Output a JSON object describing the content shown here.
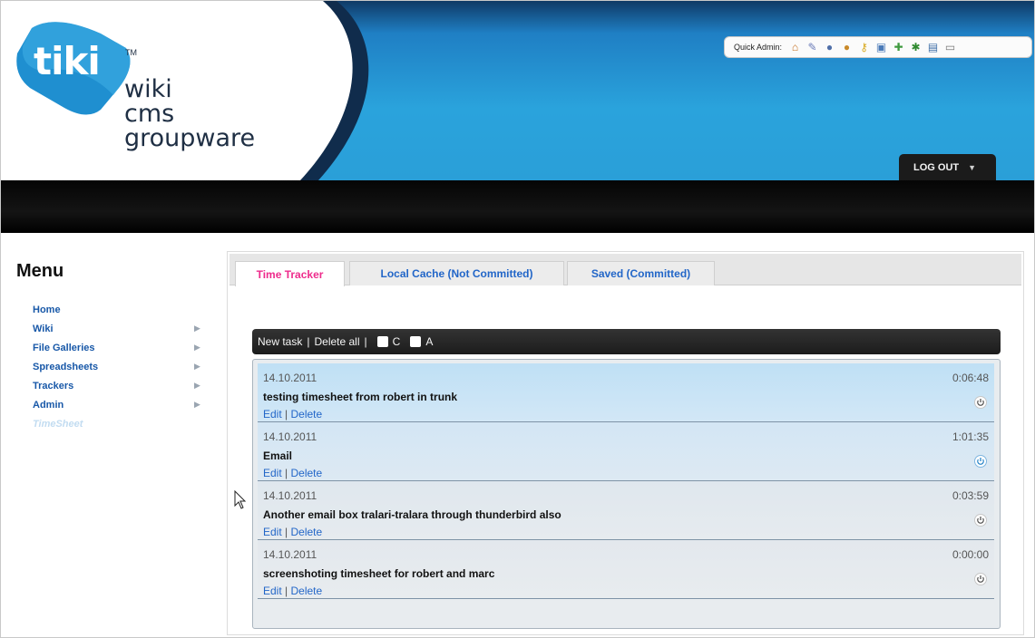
{
  "header": {
    "logo_word": "tiki",
    "trademark": "TM",
    "logo_lines": [
      "wiki",
      "cms",
      "groupware"
    ],
    "quick_admin_label": "Quick Admin:",
    "quick_admin_icons": [
      "home-icon",
      "brush-icon",
      "user-icon",
      "users-icon",
      "key-icon",
      "window-icon",
      "puzzle-icon",
      "plugin-icon",
      "document-icon",
      "keyboard-icon"
    ],
    "logout_label": "LOG OUT"
  },
  "menu": {
    "title": "Menu",
    "items": [
      {
        "label": "Home",
        "has_submenu": false
      },
      {
        "label": "Wiki",
        "has_submenu": true
      },
      {
        "label": "File Galleries",
        "has_submenu": true
      },
      {
        "label": "Spreadsheets",
        "has_submenu": true
      },
      {
        "label": "Trackers",
        "has_submenu": true
      },
      {
        "label": "Admin",
        "has_submenu": true
      },
      {
        "label": "TimeSheet",
        "has_submenu": false
      }
    ]
  },
  "tabs": [
    {
      "label": "Time Tracker",
      "active": true
    },
    {
      "label": "Local Cache (Not Committed)",
      "active": false
    },
    {
      "label": "Saved (Committed)",
      "active": false
    }
  ],
  "toolbar": {
    "new_task": "New task",
    "sep1": "|",
    "delete_all": "Delete all",
    "sep2": "|",
    "checkbox_c_label": "C",
    "checkbox_a_label": "A"
  },
  "tasks": [
    {
      "date": "14.10.2011",
      "duration": "0:06:48",
      "title": "testing timesheet from robert in trunk",
      "edit": "Edit",
      "sep": "|",
      "delete": "Delete"
    },
    {
      "date": "14.10.2011",
      "duration": "1:01:35",
      "title": "Email",
      "edit": "Edit",
      "sep": "|",
      "delete": "Delete"
    },
    {
      "date": "14.10.2011",
      "duration": "0:03:59",
      "title": "Another email box tralari-tralara through thunderbird also",
      "edit": "Edit",
      "sep": "|",
      "delete": "Delete"
    },
    {
      "date": "14.10.2011",
      "duration": "0:00:00",
      "title": "screenshoting timesheet for robert and marc",
      "edit": "Edit",
      "sep": "|",
      "delete": "Delete"
    }
  ],
  "colors": {
    "header_blue": "#2a9fd8",
    "header_navy": "#102c4c",
    "logo_blue": "#1f8fd0",
    "tab_active": "#ee2b8c",
    "link_blue": "#2266c8",
    "menu_link": "#1858a8"
  }
}
